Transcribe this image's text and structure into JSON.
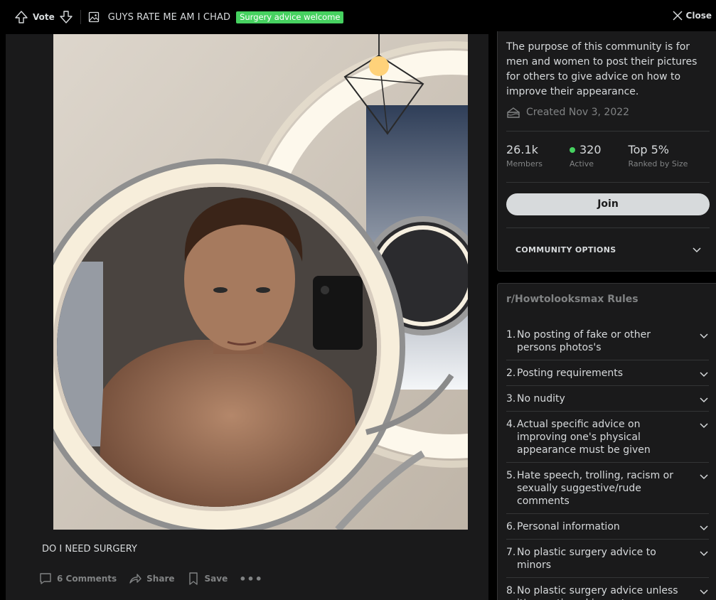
{
  "topbar": {
    "vote_label": "Vote",
    "post_title": "GUYS RATE ME AM I CHAD",
    "flair": "Surgery advice welcome",
    "flair_color": "#46d160",
    "close_label": "Close"
  },
  "post": {
    "image_alt": "Shirtless young man taking a selfie in a round lighted mirror",
    "body_text": "DO I NEED SURGERY",
    "actions": {
      "comments": "6 Comments",
      "share": "Share",
      "save": "Save",
      "more": "•••"
    }
  },
  "about": {
    "description": "The purpose of this community is for men and women to post their pictures for others to give advice on how to improve their appearance.",
    "created": "Created Nov 3, 2022",
    "stats": [
      {
        "value": "26.1k",
        "label": "Members"
      },
      {
        "value": "320",
        "label": "Active"
      },
      {
        "value": "Top 5%",
        "label": "Ranked by Size"
      }
    ],
    "join_label": "Join",
    "options_label": "COMMUNITY OPTIONS"
  },
  "rules": {
    "title": "r/Howtolooksmax Rules",
    "items": [
      {
        "num": "1.",
        "text": "No posting of fake or other persons photos's"
      },
      {
        "num": "2.",
        "text": "Posting requirements"
      },
      {
        "num": "3.",
        "text": "No nudity"
      },
      {
        "num": "4.",
        "text": "Actual specific advice on improving one's physical appearance must be given"
      },
      {
        "num": "5.",
        "text": "Hate speech, trolling, racism or sexually suggestive/rude comments"
      },
      {
        "num": "6.",
        "text": "Personal information"
      },
      {
        "num": "7.",
        "text": "No plastic surgery advice to minors"
      },
      {
        "num": "8.",
        "text": "No plastic surgery advice unless it's mentioned in post"
      }
    ]
  },
  "colors": {
    "background": "#000000",
    "panel": "#1a1a1b",
    "border": "#343536",
    "text": "#d7dadc",
    "muted": "#818384",
    "active_dot": "#46d160"
  }
}
